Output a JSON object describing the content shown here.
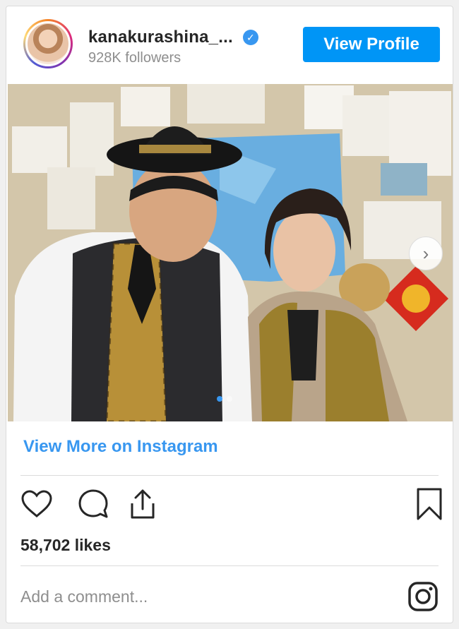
{
  "profile": {
    "username": "kanakurashina_...",
    "followers": "928K followers",
    "view_profile_label": "View Profile"
  },
  "post": {
    "view_more_label": "View More on Instagram",
    "likes": "58,702 likes",
    "comment_placeholder": "Add a comment...",
    "carousel": {
      "total": 2,
      "current": 1
    }
  },
  "icons": {
    "verified": "verified-badge-icon",
    "next": "chevron-right-icon",
    "like": "heart-icon",
    "comment": "comment-icon",
    "share": "share-icon",
    "save": "bookmark-icon",
    "brand": "instagram-icon"
  },
  "colors": {
    "accent": "#0095f6",
    "link": "#3897f0",
    "muted": "#8e8e8e"
  }
}
